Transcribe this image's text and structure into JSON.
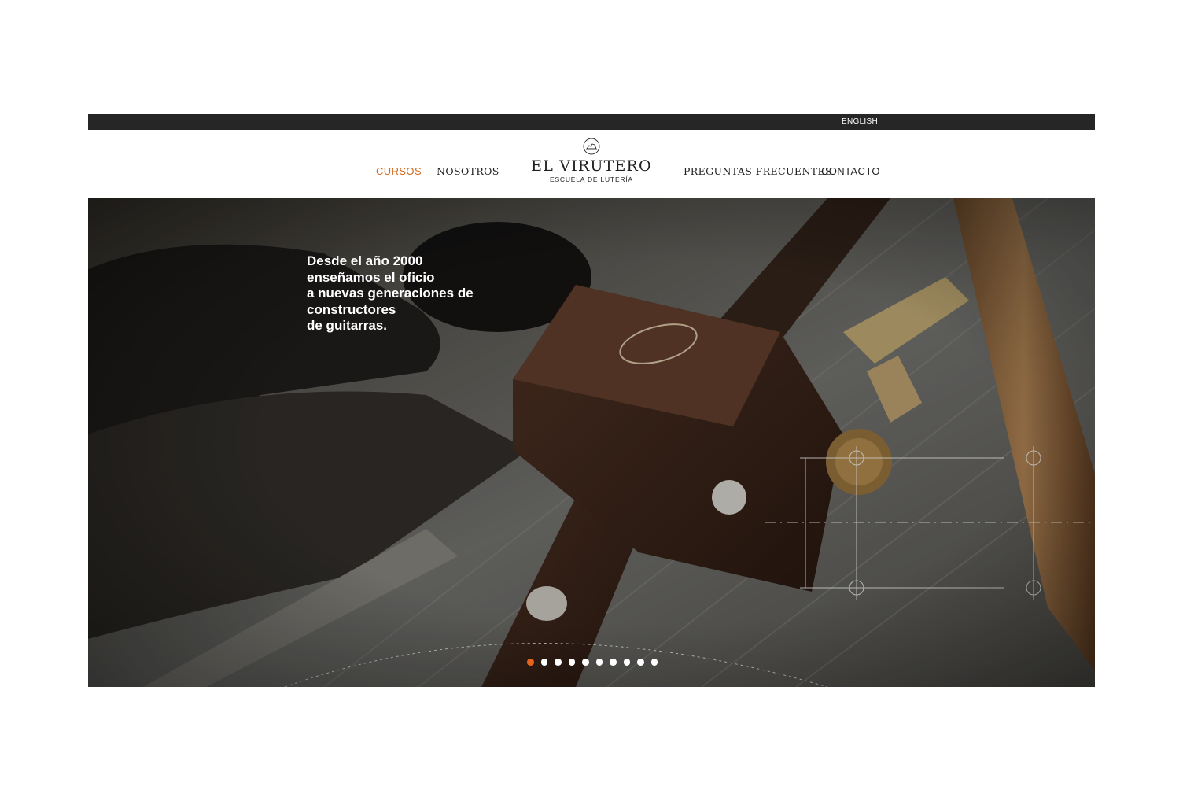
{
  "topbar": {
    "language_link": "ENGLISH"
  },
  "nav": {
    "left_items": [
      {
        "label": "CURSOS",
        "active": true
      },
      {
        "label": "NOSOTROS",
        "active": false
      }
    ],
    "right_items": [
      {
        "label": "PREGUNTAS FRECUENTES",
        "active": false
      },
      {
        "label": "CONTACTO",
        "active": false
      }
    ]
  },
  "logo": {
    "title": "EL VIRUTERO",
    "subtitle": "ESCUELA DE LUTERÍA",
    "icon": "hand-plane-icon"
  },
  "hero": {
    "tagline_lines": [
      "Desde el año 2000",
      "enseñamos el oficio",
      "a nuevas generaciones de",
      "constructores",
      "de guitarras."
    ],
    "carousel": {
      "total_slides": 10,
      "active_index": 0
    }
  },
  "colors": {
    "accent": "#d46a1c",
    "active_dot": "#e4641d",
    "topbar": "#262626"
  }
}
